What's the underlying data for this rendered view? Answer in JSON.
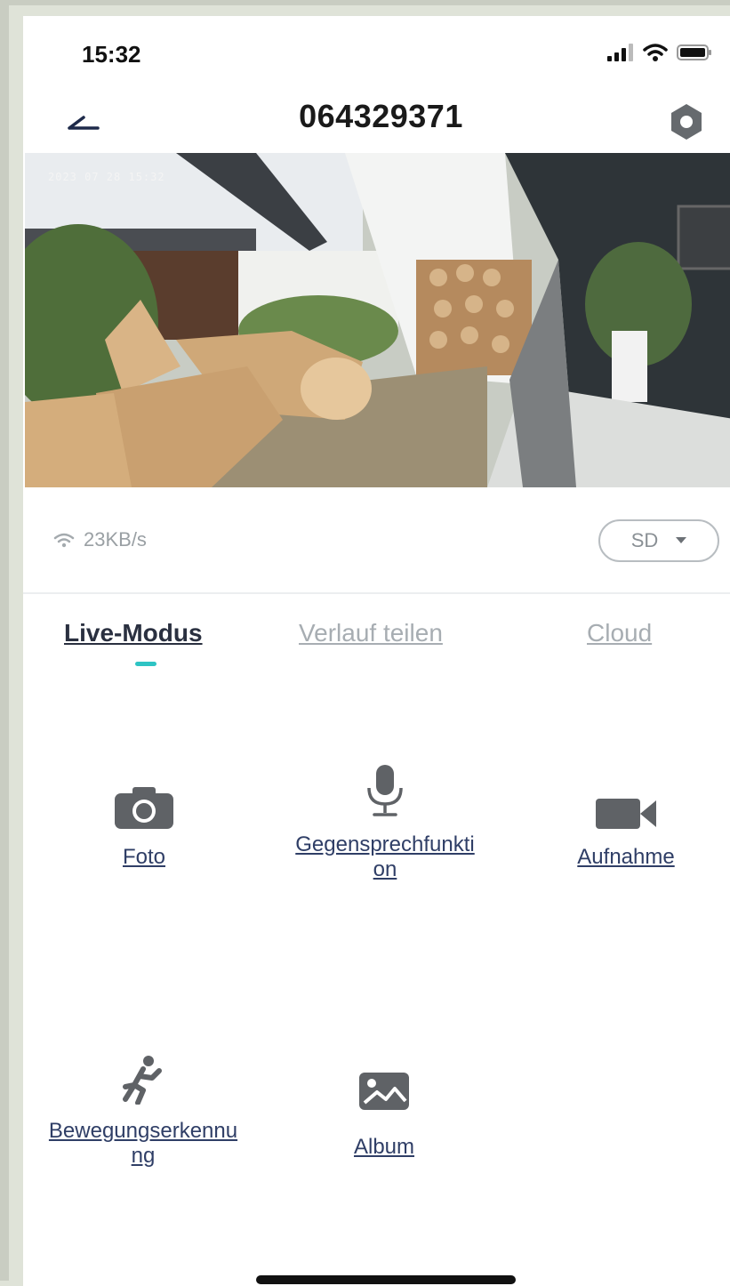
{
  "status_bar": {
    "time": "15:32"
  },
  "header": {
    "title": "064329371"
  },
  "video": {
    "timestamp": "2023 07 28 15:32"
  },
  "stream": {
    "speed": "23KB/s",
    "quality": "SD"
  },
  "tabs": [
    {
      "label": "Live-Modus",
      "active": true
    },
    {
      "label": "Verlauf teilen",
      "active": false
    },
    {
      "label": "Cloud",
      "active": false
    }
  ],
  "actions": {
    "photo": {
      "label": "Foto",
      "icon": "camera-icon"
    },
    "talk": {
      "line1": "Gegensprechfunkti",
      "line2": "on",
      "icon": "microphone-icon"
    },
    "record": {
      "label": "Aufnahme",
      "icon": "video-camera-icon"
    },
    "motion": {
      "line1": "Bewegungserkennu",
      "line2": "ng",
      "icon": "running-person-icon"
    },
    "album": {
      "label": "Album",
      "icon": "image-icon"
    }
  },
  "colors": {
    "accent": "#2ec4c4",
    "label": "#2f3e66",
    "icon": "#5f6266"
  }
}
